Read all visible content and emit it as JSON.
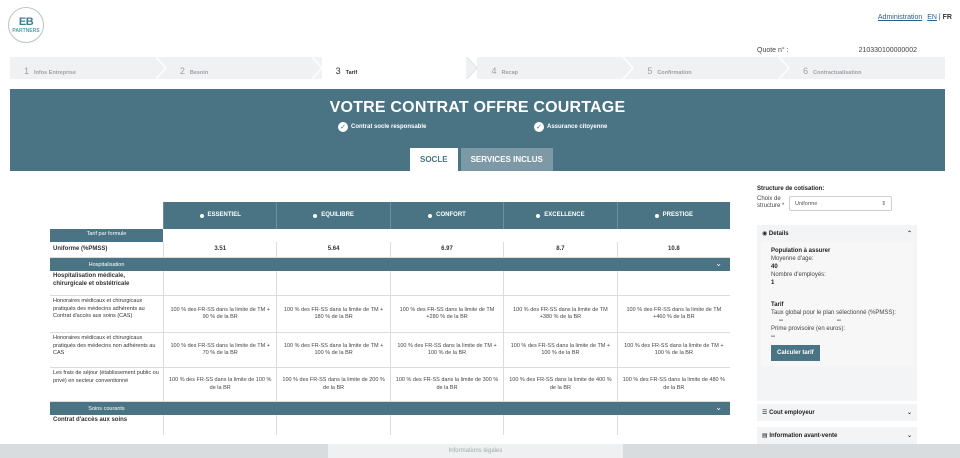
{
  "header": {
    "logo_top": "EB",
    "logo_bottom": "PARTNERS",
    "admin_link": "Administration",
    "lang_en": "EN",
    "lang_sep": " | ",
    "lang_fr": "FR",
    "quote_label": "Quote n° :",
    "quote_value": "210330100000002"
  },
  "steps": [
    {
      "num": "1",
      "label": "Infos Entreprise"
    },
    {
      "num": "2",
      "label": "Besoin"
    },
    {
      "num": "3",
      "label": "Tarif"
    },
    {
      "num": "4",
      "label": "Recap"
    },
    {
      "num": "5",
      "label": "Confirmation"
    },
    {
      "num": "6",
      "label": "Contractualisation"
    }
  ],
  "active_step": 3,
  "banner": {
    "title": "VOTRE CONTRAT OFFRE COURTAGE",
    "badge1": "Contrat socle responsable",
    "badge2": "Assurance citoyenne",
    "tab_socle": "SOCLE",
    "tab_services": "SERVICES INCLUS"
  },
  "table": {
    "formulas": [
      "ESSENTIEL",
      "EQUILIBRE",
      "CONFORT",
      "EXCELLENCE",
      "PRESTIGE"
    ],
    "tarif_label": "Tarif par formule",
    "uniforme_label": "Uniforme (%PMSS)",
    "uniforme_values": [
      "3.51",
      "5.64",
      "6.97",
      "8.7",
      "10.8"
    ],
    "section_hosp": "Hospitalisation",
    "subhead_hosp": "Hospitalisation médicale, chirurgicale et obstétricale",
    "rows": [
      {
        "label": "Honoraires médicaux et chirurgicaux pratiqués des médecins adhérents au Contrat d'accès aux soins (CAS)",
        "values": [
          "100 % des FR-SS dans la limite de TM + 90 % de la BR",
          "100 % des FR-SS dans la limite de TM + 180 % de la BR",
          "100 % des FR-SS dans la limite de TM +280 % de la BR",
          "100 % des FR-SS dans la limite de TM +380 % de la BR",
          "100 % des FR-SS dans la limite de TM +460 % de la BR"
        ]
      },
      {
        "label": "Honoraires médicaux et chirurgicaux pratiqués des médecins non adhérents au CAS",
        "values": [
          "100 % des FR-SS dans la limite de TM + 70 % de la BR",
          "100 % des FR-SS dans la limite de TM + 100 % de la BR",
          "100 % des FR-SS dans la limite de TM + 100 % de la BR",
          "100 % des FR-SS dans la limite de TM + 100 % de la BR",
          "100 % des FR-SS dans la limite de TM + 100 % de la BR"
        ]
      },
      {
        "label": "Les frais de séjour (établissement public ou privé) en secteur conventionné",
        "values": [
          "100 % des FR-SS dans la limite de 100 % de la BR",
          "100 % des FR-SS dans la limite de 200 % de la BR",
          "100 % des FR-SS dans la limite de 300 % de la BR",
          "100 % des FR-SS dans la limite de 400 % de la BR",
          "100 % des FR-SS dans la limite de 480 % de la BR"
        ]
      }
    ],
    "section_soins": "Soins courants",
    "subhead_soins": "Contrat d'accès aux soins"
  },
  "right_panel": {
    "structure_title": "Structure de cotisation:",
    "structure_label": "Choix de structure *",
    "structure_value": "Uniforme",
    "details_title": "Details",
    "population_title": "Population à assurer",
    "age_label": "Moyenne d'age:",
    "age_value": "40",
    "employees_label": "Nombre d'employés:",
    "employees_value": "1",
    "tarif_title": "Tarif",
    "taux_label": "Taux global pour le plan sélectionné (%PMSS):",
    "taux_value": "--",
    "taux_value2": "--",
    "prime_label": "Prime provisoire (en euros):",
    "prime_value": "--",
    "calc_button": "Calculer tarif",
    "cout_title": "Cout employeur",
    "info_title": "Information avant-vente"
  },
  "footer": {
    "legal": "Informations légales"
  },
  "colors": {
    "primary": "#4a7384",
    "banner": "#4a7384",
    "steps_bg": "#f0f1f2"
  }
}
